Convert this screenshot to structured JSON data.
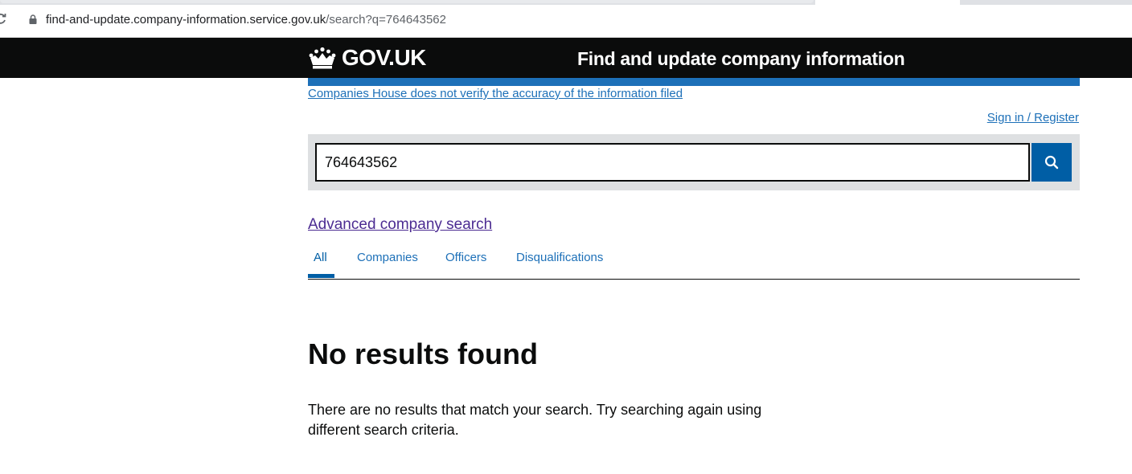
{
  "browser": {
    "url_host": "find-and-update.company-information.service.gov.uk",
    "url_path": "/search?q=764643562"
  },
  "header": {
    "logo_text": "GOV.UK",
    "service_name": "Find and update company information"
  },
  "notice": {
    "link_text": "Companies House does not verify the accuracy of the information filed"
  },
  "account": {
    "signin_label": "Sign in / Register"
  },
  "search": {
    "query": "764643562"
  },
  "advanced_search": {
    "label": "Advanced company search"
  },
  "tabs": [
    {
      "label": "All",
      "active": true
    },
    {
      "label": "Companies",
      "active": false
    },
    {
      "label": "Officers",
      "active": false
    },
    {
      "label": "Disqualifications",
      "active": false
    }
  ],
  "results": {
    "title": "No results found",
    "message": "There are no results that match your search. Try searching again using different search criteria."
  },
  "colors": {
    "header_bg": "#0b0c0c",
    "brand_blue": "#1d70b8",
    "button_blue": "#005ea5",
    "visited_link": "#4c2c92"
  }
}
